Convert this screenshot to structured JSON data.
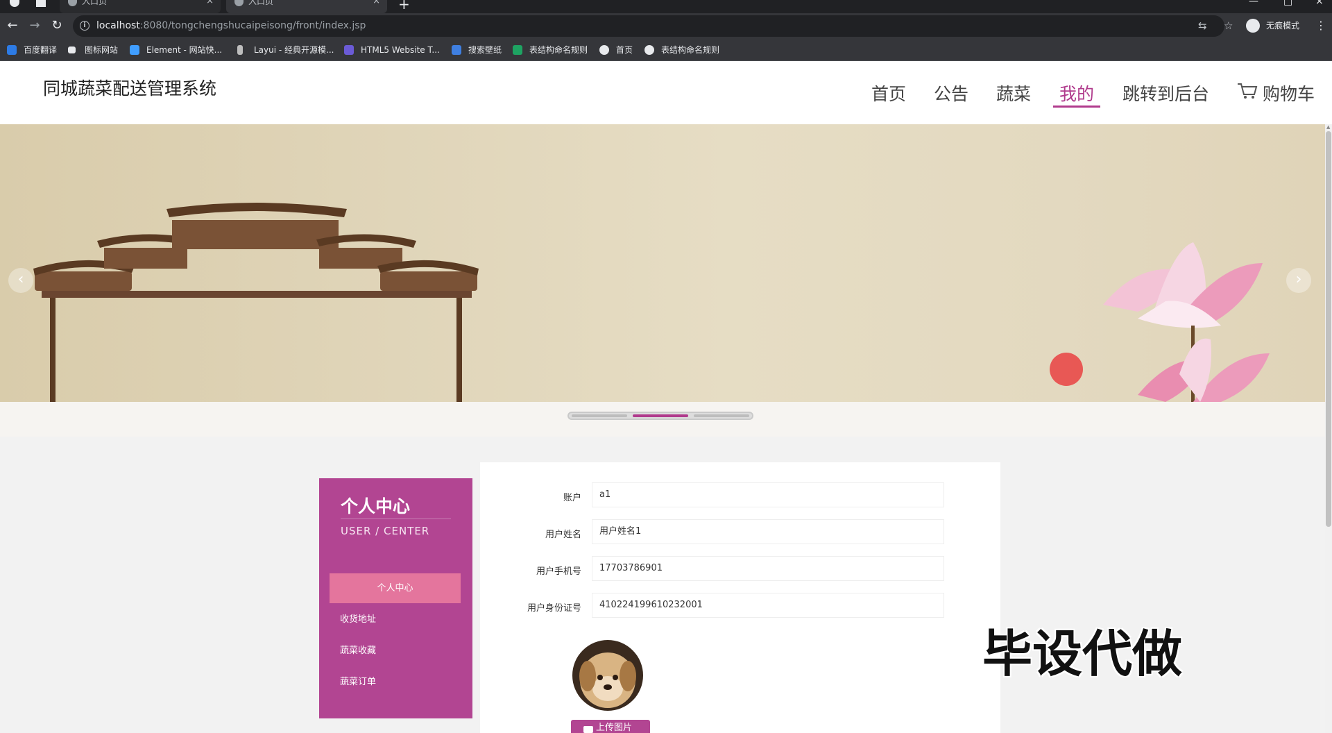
{
  "browser": {
    "tabs": [
      {
        "title": "入口页",
        "close": "×"
      },
      {
        "title": "入口页",
        "close": "×"
      }
    ],
    "new_tab": "+",
    "window_controls": {
      "minimize": "—",
      "maximize": "□",
      "close": "×"
    },
    "nav": {
      "back": "←",
      "forward": "→",
      "reload": "↻"
    },
    "address": {
      "info": "i",
      "host": "localhost",
      "path": ":8080/tongchengshucaipeisong/front/index.jsp"
    },
    "omni_icons": {
      "translate": "⇆",
      "star": "☆"
    },
    "profile_label": "无痕模式",
    "menu": "⋮",
    "bookmarks": [
      {
        "label": "百度翻译",
        "icon": "baidu-translate-icon",
        "color": "#2d7be5"
      },
      {
        "label": "图标网站",
        "icon": "flag-icon",
        "color": "#e8eaed"
      },
      {
        "label": "Element - 网站快...",
        "icon": "element-icon",
        "color": "#409eff"
      },
      {
        "label": "Layui - 经典开源模...",
        "icon": "layui-icon",
        "color": "#bdbdbd"
      },
      {
        "label": "HTML5 Website T...",
        "icon": "html5-template-icon",
        "color": "#6b5bd6"
      },
      {
        "label": "搜索壁纸",
        "icon": "wallpaper-icon",
        "color": "#3f7fe0"
      },
      {
        "label": "表结构命名规则",
        "icon": "sheet-icon",
        "color": "#1ea362"
      },
      {
        "label": "首页",
        "icon": "globe-icon",
        "color": "#e8eaed"
      },
      {
        "label": "表结构命名规则",
        "icon": "globe-icon",
        "color": "#e8eaed"
      }
    ]
  },
  "header": {
    "site_title": "同城蔬菜配送管理系统",
    "nav": [
      {
        "label": "首页",
        "active": false
      },
      {
        "label": "公告",
        "active": false
      },
      {
        "label": "蔬菜",
        "active": false
      },
      {
        "label": "我的",
        "active": true
      },
      {
        "label": "跳转到后台",
        "active": false
      },
      {
        "label": "购物车",
        "active": false
      }
    ]
  },
  "carousel": {
    "prev": "‹",
    "next": "›",
    "slide_count": 3,
    "active_slide": 2
  },
  "sidebar": {
    "title": "个人中心",
    "subtitle": "USER / CENTER",
    "items": [
      {
        "label": "个人中心",
        "active": true
      },
      {
        "label": "收货地址",
        "active": false
      },
      {
        "label": "蔬菜收藏",
        "active": false
      },
      {
        "label": "蔬菜订单",
        "active": false
      }
    ]
  },
  "form": {
    "fields": [
      {
        "label": "账户",
        "value": "a1"
      },
      {
        "label": "用户姓名",
        "value": "用户姓名1"
      },
      {
        "label": "用户手机号",
        "value": "17703786901"
      },
      {
        "label": "用户身份证号",
        "value": "410224199610232001"
      }
    ],
    "upload_label": "上传图片"
  },
  "overlay": {
    "watermark": "毕设代做"
  },
  "colors": {
    "accent": "#b24592",
    "nav_active": "#b03a8c",
    "sidebar_active": "#e4759d",
    "chrome_dark": "#35363a"
  }
}
